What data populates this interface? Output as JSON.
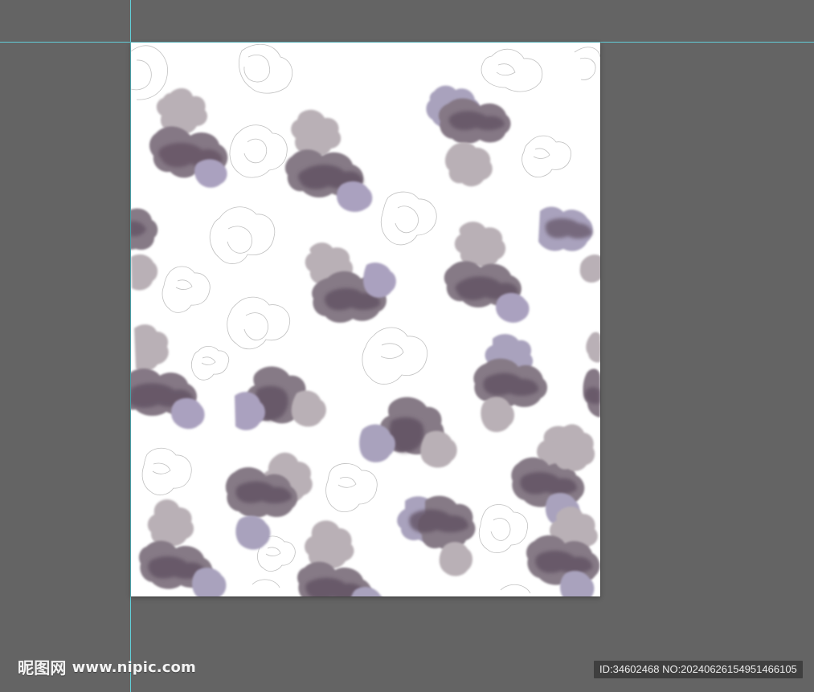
{
  "workspace": {
    "background": "#646464",
    "guide_color": "#62d4de",
    "canvas_background": "#ffffff"
  },
  "pattern": {
    "ink_dark": "#5f5060",
    "ink_mid": "#867a86",
    "ink_light": "#b9b0b6",
    "ink_cool": "#a9a2bd",
    "line_color": "#8f8f8f"
  },
  "watermark": {
    "site_name": "昵图网",
    "site_url": "www.nipic.com",
    "id_text": "ID:34602468 NO:20240626154951466105"
  }
}
